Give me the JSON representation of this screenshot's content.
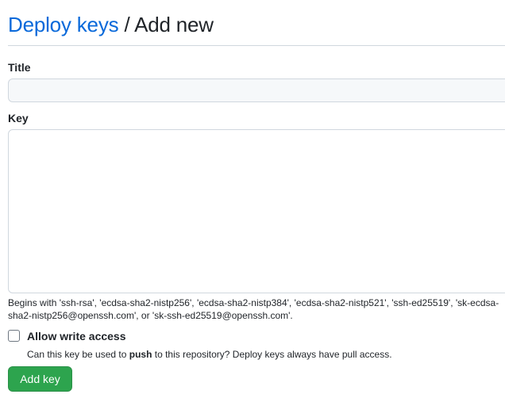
{
  "breadcrumb": {
    "link_label": "Deploy keys",
    "separator": " / ",
    "current_label": "Add new"
  },
  "form": {
    "title_label": "Title",
    "title_value": "",
    "key_label": "Key",
    "key_value": "",
    "key_hint": "Begins with 'ssh-rsa', 'ecdsa-sha2-nistp256', 'ecdsa-sha2-nistp384', 'ecdsa-sha2-nistp521', 'ssh-ed25519', 'sk-ecdsa-sha2-nistp256@openssh.com', or 'sk-ssh-ed25519@openssh.com'.",
    "write_access": {
      "label": "Allow write access",
      "checked": false,
      "note_prefix": "Can this key be used to ",
      "note_bold": "push",
      "note_suffix": " to this repository? Deploy keys always have pull access."
    },
    "submit_label": "Add key"
  },
  "colors": {
    "link": "#0969da",
    "primary_button": "#2da44e",
    "border": "#d0d7de"
  }
}
